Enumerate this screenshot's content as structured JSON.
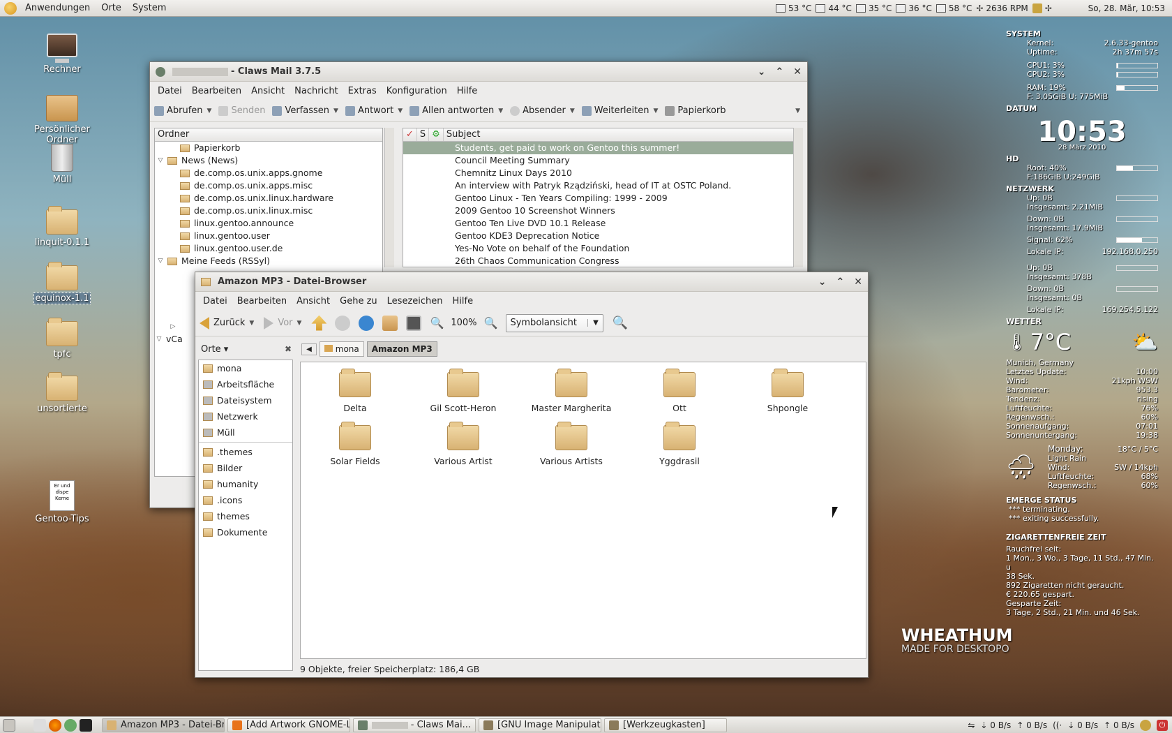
{
  "top_panel": {
    "menus": [
      "Anwendungen",
      "Orte",
      "System"
    ],
    "sensors": [
      "53 °C",
      "44 °C",
      "35 °C",
      "36 °C",
      "58 °C",
      "2636 RPM"
    ],
    "clock": "So, 28. Mär, 10:53"
  },
  "desktop_icons": [
    "Rechner",
    "Persönlicher Ordner",
    "Müll",
    "linquit-0.1.1",
    "equinox-1.1",
    "tpfc",
    "unsortierte",
    "Gentoo-Tips"
  ],
  "gentoo_doc_text": [
    "Er und",
    "dispe",
    "Kerne"
  ],
  "claws": {
    "title": "- Claws Mail 3.7.5",
    "menu": [
      "Datei",
      "Bearbeiten",
      "Ansicht",
      "Nachricht",
      "Extras",
      "Konfiguration",
      "Hilfe"
    ],
    "toolbar": [
      "Abrufen",
      "Senden",
      "Verfassen",
      "Antwort",
      "Allen antworten",
      "Absender",
      "Weiterleiten",
      "Papierkorb"
    ],
    "folder_header": "Ordner",
    "folders": [
      {
        "label": "Papierkorb",
        "level": 1,
        "exp": ""
      },
      {
        "label": "News (News)",
        "level": 0,
        "exp": "▽"
      },
      {
        "label": "de.comp.os.unix.apps.gnome",
        "level": 1,
        "exp": ""
      },
      {
        "label": "de.comp.os.unix.apps.misc",
        "level": 1,
        "exp": ""
      },
      {
        "label": "de.comp.os.unix.linux.hardware",
        "level": 1,
        "exp": ""
      },
      {
        "label": "de.comp.os.unix.linux.misc",
        "level": 1,
        "exp": ""
      },
      {
        "label": "linux.gentoo.announce",
        "level": 1,
        "exp": ""
      },
      {
        "label": "linux.gentoo.user",
        "level": 1,
        "exp": ""
      },
      {
        "label": "linux.gentoo.user.de",
        "level": 1,
        "exp": ""
      },
      {
        "label": "Meine Feeds (RSSyl)",
        "level": 0,
        "exp": "▽"
      }
    ],
    "msg_columns": [
      "✓",
      "S",
      "⚙",
      "Subject"
    ],
    "messages": [
      "Students, get paid to work on Gentoo this summer!",
      "Council Meeting Summary",
      "Chemnitz  Linux Days 2010",
      "An interview with Patryk Rządziński, head of IT at OSTC Poland.",
      "Gentoo Linux - Ten Years Compiling: 1999 - 2009",
      "2009 Gentoo 10 Screenshot Winners",
      "Gentoo Ten Live DVD 10.1 Release",
      "Gentoo KDE3 Deprecation Notice",
      "Yes-No Vote on behalf of the Foundation",
      "26th Chaos Communication Congress"
    ],
    "vcard_label": "vCa"
  },
  "filebrowser": {
    "title": "Amazon MP3 - Datei-Browser",
    "menu": [
      "Datei",
      "Bearbeiten",
      "Ansicht",
      "Gehe zu",
      "Lesezeichen",
      "Hilfe"
    ],
    "back": "Zurück",
    "forward": "Vor",
    "zoom": "100%",
    "view_mode": "Symbolansicht",
    "places_label": "Orte ▾",
    "path": [
      "mona",
      "Amazon MP3"
    ],
    "places": [
      "mona",
      "Arbeitsfläche",
      "Dateisystem",
      "Netzwerk",
      "Müll"
    ],
    "bookmarks": [
      ".themes",
      "Bilder",
      "humanity",
      ".icons",
      "themes",
      "Dokumente"
    ],
    "items": [
      "Delta",
      "Gil Scott-Heron",
      "Master Margherita",
      "Ott",
      "Shpongle",
      "Solar Fields",
      "Various Artist",
      "Various Artists",
      "Yggdrasil"
    ],
    "status": "9 Objekte, freier Speicherplatz: 186,4 GB"
  },
  "conky": {
    "system": "SYSTEM",
    "kernel_label": "Kernel:",
    "kernel": "2.6.33-gentoo",
    "uptime_label": "Uptime:",
    "uptime": "2h 37m 57s",
    "cpu1": "CPU1: 3%",
    "cpu2": "CPU2: 3%",
    "ram": "RAM: 19%",
    "ram_detail": "F: 3.05GiB U: 775MiB",
    "datum": "DATUM",
    "time": "10:53",
    "date": "28 März 2010",
    "hd": "HD",
    "root": "Root: 40%",
    "root_detail": "F:186GiB U:249GiB",
    "netzwerk": "NETZWERK",
    "up1": "Up: 0B",
    "total_up1": "Insgesamt: 2.21MiB",
    "down1": "Down: 0B",
    "total_down1": "Insgesamt: 17.9MiB",
    "signal": "Signal: 62%",
    "ip_label1": "Lokale IP:",
    "ip1": "192.168.0.250",
    "up2": "Up: 0B",
    "total_up2": "Insgesamt: 378B",
    "down2": "Down: 0B",
    "total_down2": "Insgesamt: 0B",
    "ip_label2": "Lokale IP:",
    "ip2": "169.254.5.122",
    "wetter": "WETTER",
    "temp": "7°C",
    "weather_rows": [
      [
        "Munich, Germany",
        ""
      ],
      [
        "Letztes Update:",
        "10:00"
      ],
      [
        "Wind:",
        "21kph WSW"
      ],
      [
        "Barometer:",
        "953.3"
      ],
      [
        "Tendenz:",
        "rising"
      ],
      [
        "Luftfeuchte:",
        "76%"
      ],
      [
        "Regenwsch.:",
        "60%"
      ],
      [
        "Sonnenaufgang:",
        "07:01"
      ],
      [
        "Sonnenuntergang:",
        "19:38"
      ]
    ],
    "forecast_day": "Monday:",
    "forecast_temp": "18°C / 5°C",
    "forecast_rows": [
      [
        "Light Rain",
        ""
      ],
      [
        "Wind:",
        "SW / 14kph"
      ],
      [
        "Luftfeuchte:",
        "68%"
      ],
      [
        "Regenwsch.:",
        "60%"
      ]
    ],
    "emerge": "EMERGE STATUS",
    "emerge_lines": [
      "*** terminating.",
      "*** exiting successfully."
    ],
    "zig": "ZIGARETTENFREIE ZEIT",
    "zig_lines": [
      "Rauchfrei seit:",
      "1 Mon., 3 Wo., 3 Tage, 11 Std., 47 Min. u",
      "38 Sek.",
      "892 Zigaretten nicht geraucht.",
      "€ 220.65 gespart.",
      "Gesparte Zeit:",
      "3 Tage, 2 Std., 21 Min. und 46 Sek."
    ],
    "signal_level": 0.62
  },
  "wallpaper": {
    "brand": "WHEATHUM",
    "tagline": "MADE FOR DESKTOPO"
  },
  "bottom_panel": {
    "tasks": [
      "Amazon MP3 - Datei-Br...",
      "[Add Artwork GNOME-L...",
      "- Claws Mai...",
      "[GNU Image Manipulati...",
      "[Werkzeugkasten]"
    ],
    "net1": "0 B/s",
    "net2": "0 B/s",
    "net3": "0 B/s",
    "net4": "0 B/s"
  }
}
